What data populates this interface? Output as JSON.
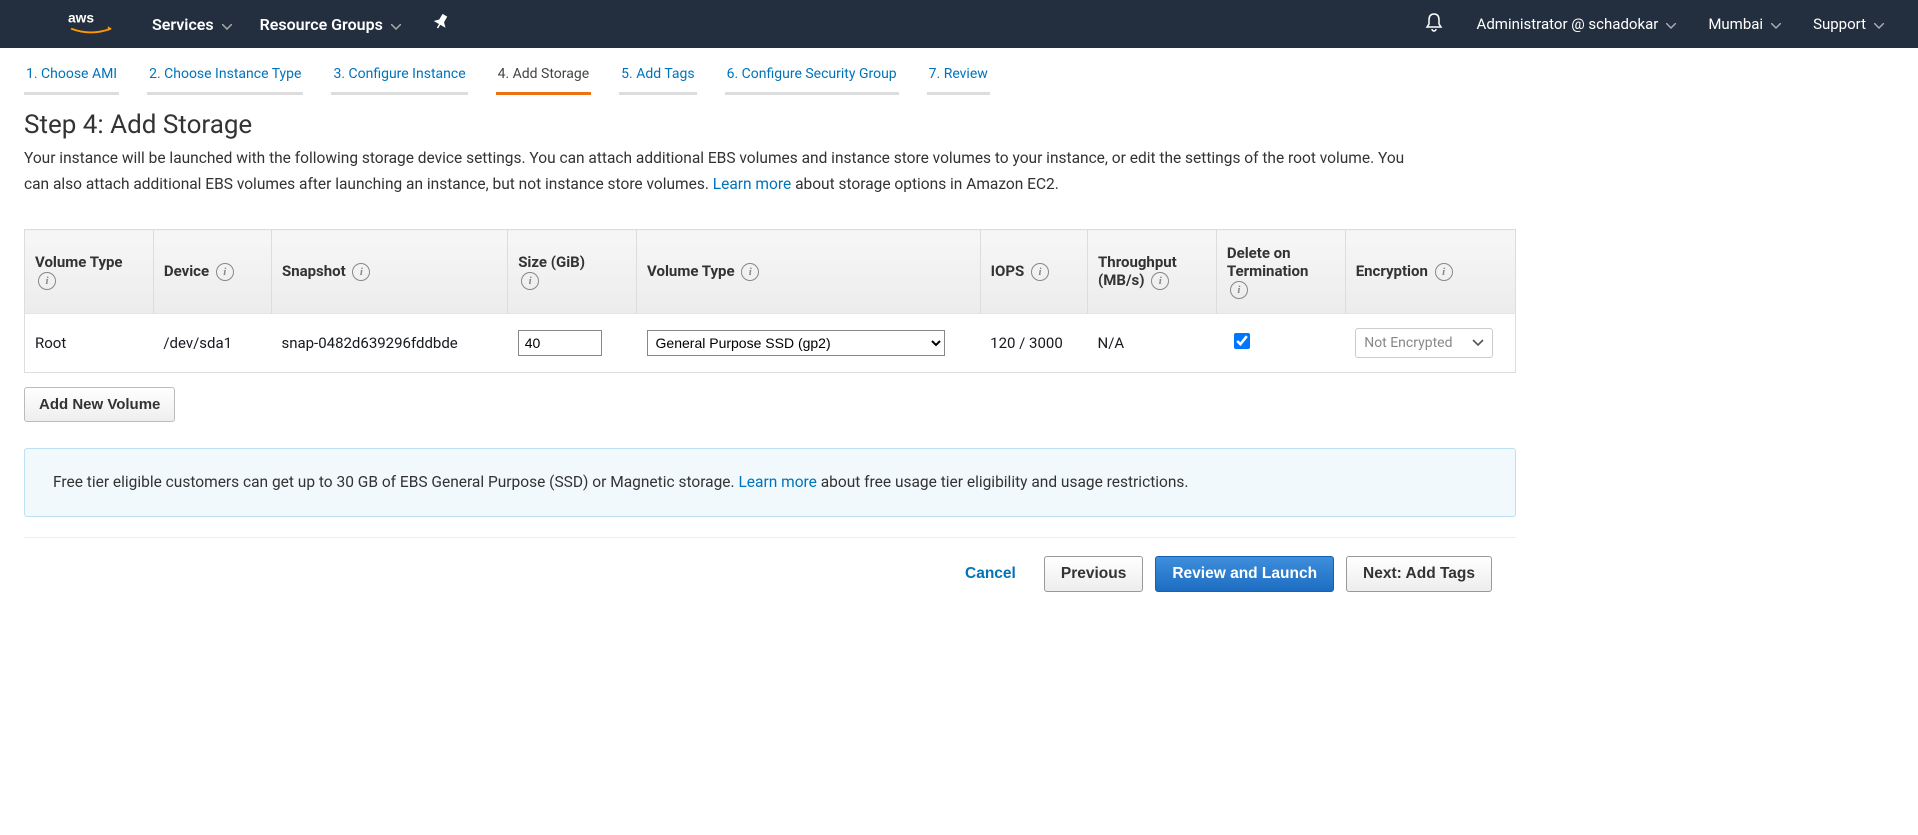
{
  "topbar": {
    "services": "Services",
    "resource_groups": "Resource Groups",
    "user": "Administrator @ schadokar",
    "region": "Mumbai",
    "support": "Support"
  },
  "tabs": [
    {
      "label": "1. Choose AMI"
    },
    {
      "label": "2. Choose Instance Type"
    },
    {
      "label": "3. Configure Instance"
    },
    {
      "label": "4. Add Storage",
      "active": true
    },
    {
      "label": "5. Add Tags"
    },
    {
      "label": "6. Configure Security Group"
    },
    {
      "label": "7. Review"
    }
  ],
  "heading": "Step 4: Add Storage",
  "lead": {
    "part1": "Your instance will be launched with the following storage device settings. You can attach additional EBS volumes and instance store volumes to your instance, or edit the settings of the root volume. You can also attach additional EBS volumes after launching an instance, but not instance store volumes. ",
    "link": "Learn more",
    "part2": " about storage options in Amazon EC2."
  },
  "table_headers": {
    "vol_type_label": "Volume Type",
    "device": "Device",
    "snapshot": "Snapshot",
    "size": "Size (GiB)",
    "vol_type": "Volume Type",
    "iops": "IOPS",
    "throughput": "Throughput (MB/s)",
    "delete_on_term": "Delete on Termination",
    "encryption": "Encryption"
  },
  "row": {
    "type_label": "Root",
    "device": "/dev/sda1",
    "snapshot": "snap-0482d639296fddbde",
    "size": "40",
    "vol_type": "General Purpose SSD (gp2)",
    "iops": "120 / 3000",
    "throughput": "N/A",
    "delete_on_term": true,
    "encryption": "Not Encrypted"
  },
  "add_volume_btn": "Add New Volume",
  "notice": {
    "part1": "Free tier eligible customers can get up to 30 GB of EBS General Purpose (SSD) or Magnetic storage. ",
    "link": "Learn more",
    "part2": " about free usage tier eligibility and usage restrictions."
  },
  "footer": {
    "cancel": "Cancel",
    "previous": "Previous",
    "review": "Review and Launch",
    "next": "Next: Add Tags"
  }
}
